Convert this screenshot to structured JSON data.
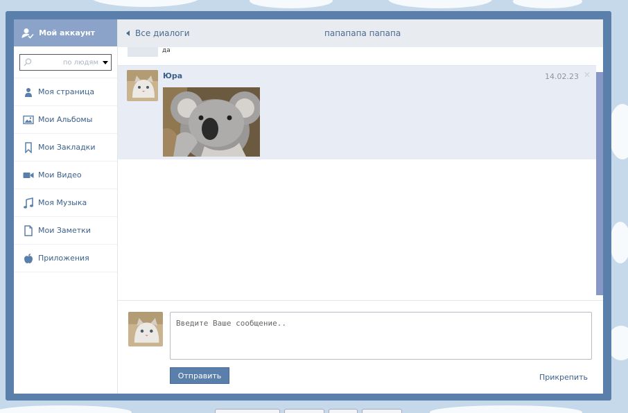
{
  "sidebar": {
    "account_label": "Мой аккаунт",
    "search": {
      "placeholder": "по людям"
    },
    "items": [
      {
        "label": "Моя страница",
        "icon": "person-icon"
      },
      {
        "label": "Мои Альбомы",
        "icon": "picture-icon"
      },
      {
        "label": "Мои Закладки",
        "icon": "bookmark-icon"
      },
      {
        "label": "Мои Видео",
        "icon": "video-camera-icon"
      },
      {
        "label": "Моя Музыка",
        "icon": "music-note-icon"
      },
      {
        "label": "Мои Заметки",
        "icon": "document-icon"
      },
      {
        "label": "Приложения",
        "icon": "apple-icon"
      }
    ]
  },
  "topbar": {
    "back_label": "Все диалоги",
    "title": "папапапа папапа"
  },
  "messages": {
    "previous_snippet": "да",
    "items": [
      {
        "author": "Юра",
        "date": "14.02.23",
        "close_glyph": "✕"
      }
    ]
  },
  "composer": {
    "placeholder": "Введите Ваше сообщение..",
    "send_label": "Отправить",
    "attach_label": "Прикрепить"
  },
  "colors": {
    "accent": "#5b7fab",
    "header": "#8ba3c8",
    "link": "#3b5f8a",
    "message_bg": "#e8ecf5",
    "scrollbar": "#8898c6"
  }
}
